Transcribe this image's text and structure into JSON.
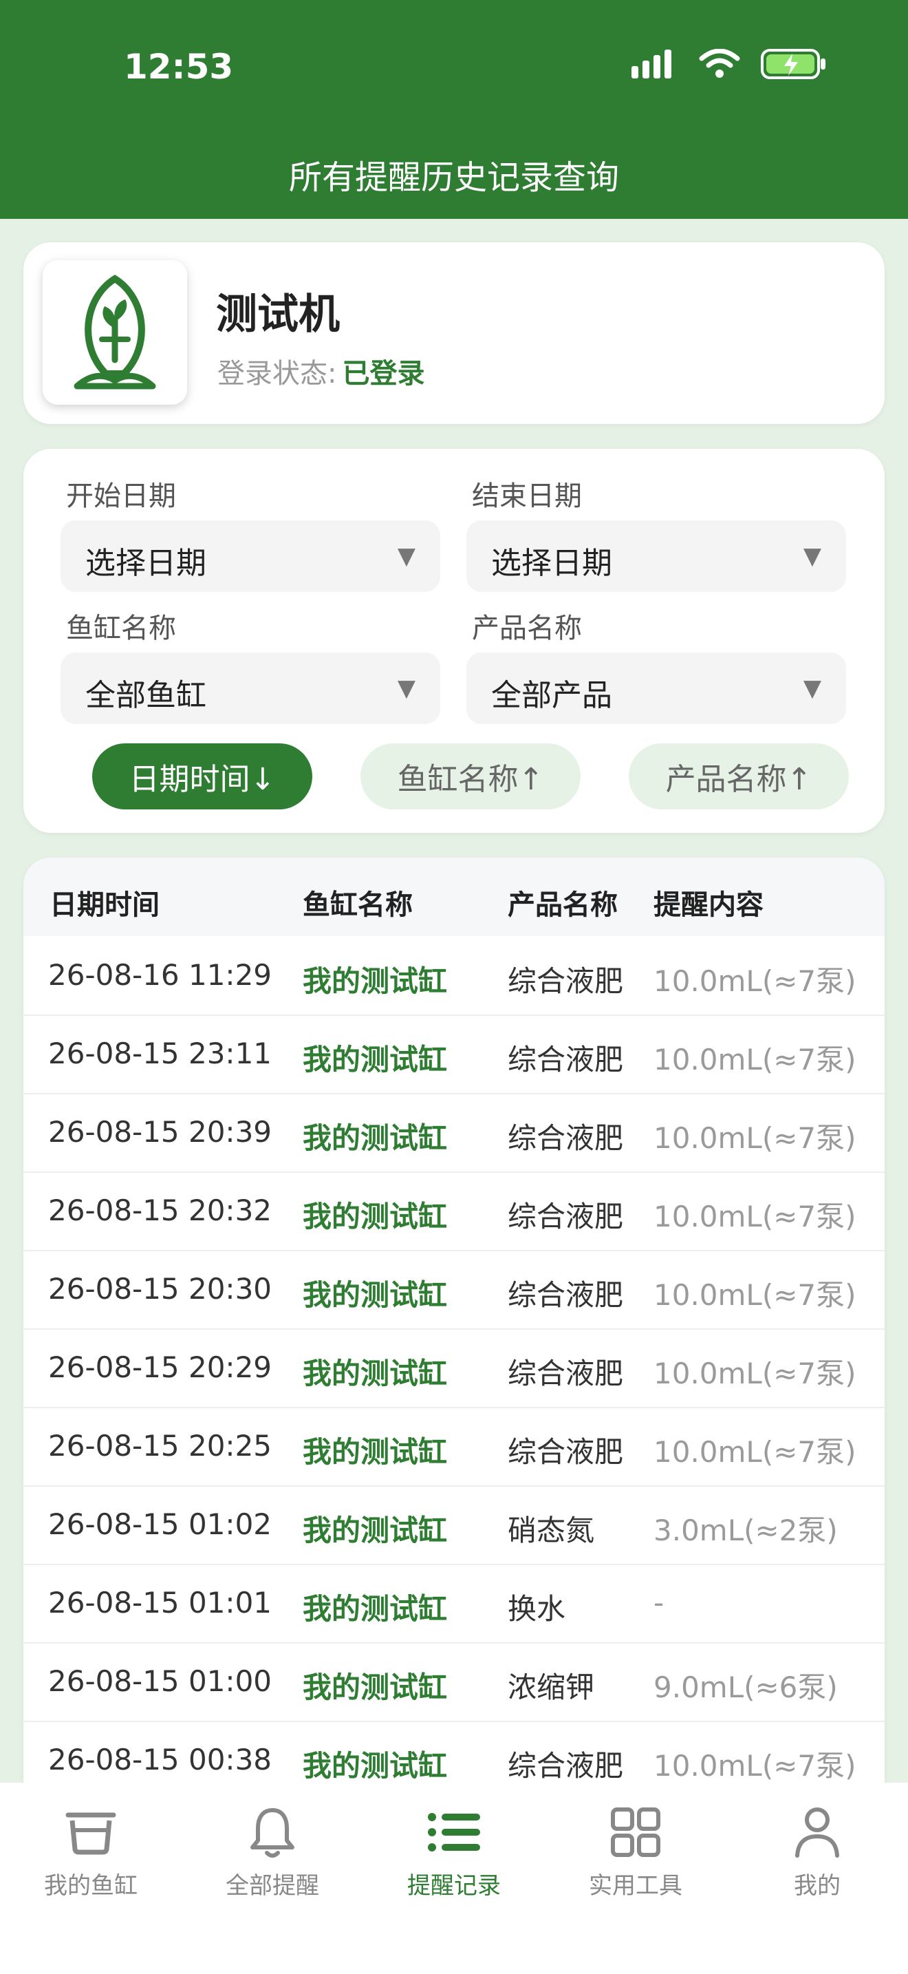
{
  "status_bar": {
    "time": "12:53"
  },
  "header": {
    "title": "所有提醒历史记录查询"
  },
  "profile": {
    "device_name": "测试机",
    "login_label": "登录状态:",
    "login_status": "已登录"
  },
  "filters": {
    "start_date": {
      "label": "开始日期",
      "value": "选择日期"
    },
    "end_date": {
      "label": "结束日期",
      "value": "选择日期"
    },
    "tank": {
      "label": "鱼缸名称",
      "value": "全部鱼缸"
    },
    "product": {
      "label": "产品名称",
      "value": "全部产品"
    },
    "arrow": "▼",
    "sort": [
      {
        "label": "日期时间↓",
        "active": true
      },
      {
        "label": "鱼缸名称↑",
        "active": false
      },
      {
        "label": "产品名称↑",
        "active": false
      }
    ]
  },
  "table": {
    "headers": [
      "日期时间",
      "鱼缸名称",
      "产品名称",
      "提醒内容"
    ],
    "rows": [
      {
        "datetime": "26-08-16 11:29",
        "tank": "我的测试缸",
        "product": "综合液肥",
        "content": "10.0mL(≈7泵)"
      },
      {
        "datetime": "26-08-15 23:11",
        "tank": "我的测试缸",
        "product": "综合液肥",
        "content": "10.0mL(≈7泵)"
      },
      {
        "datetime": "26-08-15 20:39",
        "tank": "我的测试缸",
        "product": "综合液肥",
        "content": "10.0mL(≈7泵)"
      },
      {
        "datetime": "26-08-15 20:32",
        "tank": "我的测试缸",
        "product": "综合液肥",
        "content": "10.0mL(≈7泵)"
      },
      {
        "datetime": "26-08-15 20:30",
        "tank": "我的测试缸",
        "product": "综合液肥",
        "content": "10.0mL(≈7泵)"
      },
      {
        "datetime": "26-08-15 20:29",
        "tank": "我的测试缸",
        "product": "综合液肥",
        "content": "10.0mL(≈7泵)"
      },
      {
        "datetime": "26-08-15 20:25",
        "tank": "我的测试缸",
        "product": "综合液肥",
        "content": "10.0mL(≈7泵)"
      },
      {
        "datetime": "26-08-15 01:02",
        "tank": "我的测试缸",
        "product": "硝态氮",
        "content": "3.0mL(≈2泵)"
      },
      {
        "datetime": "26-08-15 01:01",
        "tank": "我的测试缸",
        "product": "换水",
        "content": "-"
      },
      {
        "datetime": "26-08-15 01:00",
        "tank": "我的测试缸",
        "product": "浓缩钾",
        "content": "9.0mL(≈6泵)"
      },
      {
        "datetime": "26-08-15 00:38",
        "tank": "我的测试缸",
        "product": "综合液肥",
        "content": "10.0mL(≈7泵)"
      }
    ]
  },
  "tabbar": {
    "items": [
      {
        "label": "我的鱼缸",
        "icon": "tank-icon",
        "active": false
      },
      {
        "label": "全部提醒",
        "icon": "bell-icon",
        "active": false
      },
      {
        "label": "提醒记录",
        "icon": "list-icon",
        "active": true
      },
      {
        "label": "实用工具",
        "icon": "grid-icon",
        "active": false
      },
      {
        "label": "我的",
        "icon": "person-icon",
        "active": false
      }
    ]
  },
  "colors": {
    "brand": "#2e7d32",
    "background": "#e4f1e4",
    "sort_inactive": "#e6f2e6"
  }
}
